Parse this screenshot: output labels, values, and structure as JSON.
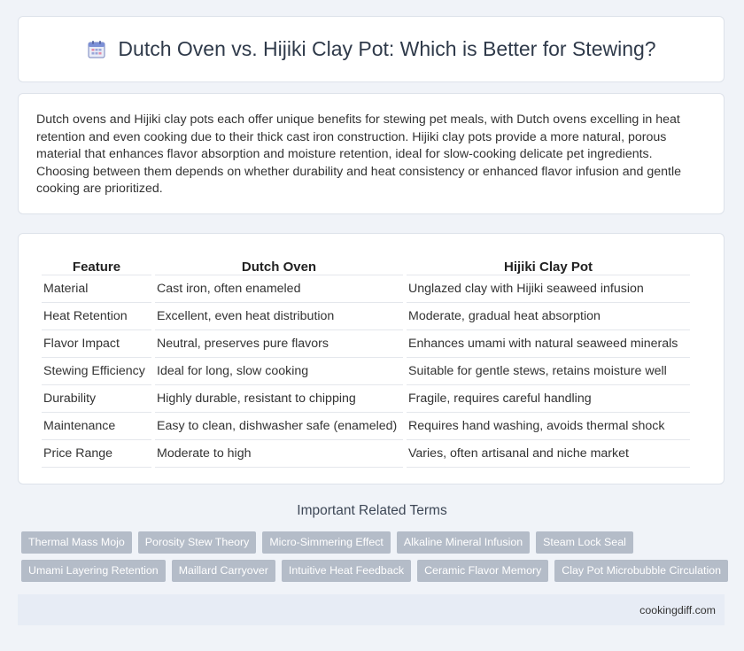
{
  "header": {
    "title": "Dutch Oven vs. Hijiki Clay Pot: Which is Better for Stewing?",
    "icon": "calendar-icon"
  },
  "intro": {
    "text": "Dutch ovens and Hijiki clay pots each offer unique benefits for stewing pet meals, with Dutch ovens excelling in heat retention and even cooking due to their thick cast iron construction. Hijiki clay pots provide a more natural, porous material that enhances flavor absorption and moisture retention, ideal for slow-cooking delicate pet ingredients. Choosing between them depends on whether durability and heat consistency or enhanced flavor infusion and gentle cooking are prioritized."
  },
  "table": {
    "headers": [
      "Feature",
      "Dutch Oven",
      "Hijiki Clay Pot"
    ],
    "rows": [
      [
        "Material",
        "Cast iron, often enameled",
        "Unglazed clay with Hijiki seaweed infusion"
      ],
      [
        "Heat Retention",
        "Excellent, even heat distribution",
        "Moderate, gradual heat absorption"
      ],
      [
        "Flavor Impact",
        "Neutral, preserves pure flavors",
        "Enhances umami with natural seaweed minerals"
      ],
      [
        "Stewing Efficiency",
        "Ideal for long, slow cooking",
        "Suitable for gentle stews, retains moisture well"
      ],
      [
        "Durability",
        "Highly durable, resistant to chipping",
        "Fragile, requires careful handling"
      ],
      [
        "Maintenance",
        "Easy to clean, dishwasher safe (enameled)",
        "Requires hand washing, avoids thermal shock"
      ],
      [
        "Price Range",
        "Moderate to high",
        "Varies, often artisanal and niche market"
      ]
    ]
  },
  "related": {
    "title": "Important Related Terms",
    "tags": [
      "Thermal Mass Mojo",
      "Porosity Stew Theory",
      "Micro-Simmering Effect",
      "Alkaline Mineral Infusion",
      "Steam Lock Seal",
      "Umami Layering Retention",
      "Maillard Carryover",
      "Intuitive Heat Feedback",
      "Ceramic Flavor Memory",
      "Clay Pot Microbubble Circulation"
    ]
  },
  "footer": {
    "site": "cookingdiff.com"
  },
  "colors": {
    "background": "#f0f3f8",
    "tag": "#b4bcc8",
    "footer": "#e7ecf5",
    "icon_accent": "#7b8fd6"
  }
}
